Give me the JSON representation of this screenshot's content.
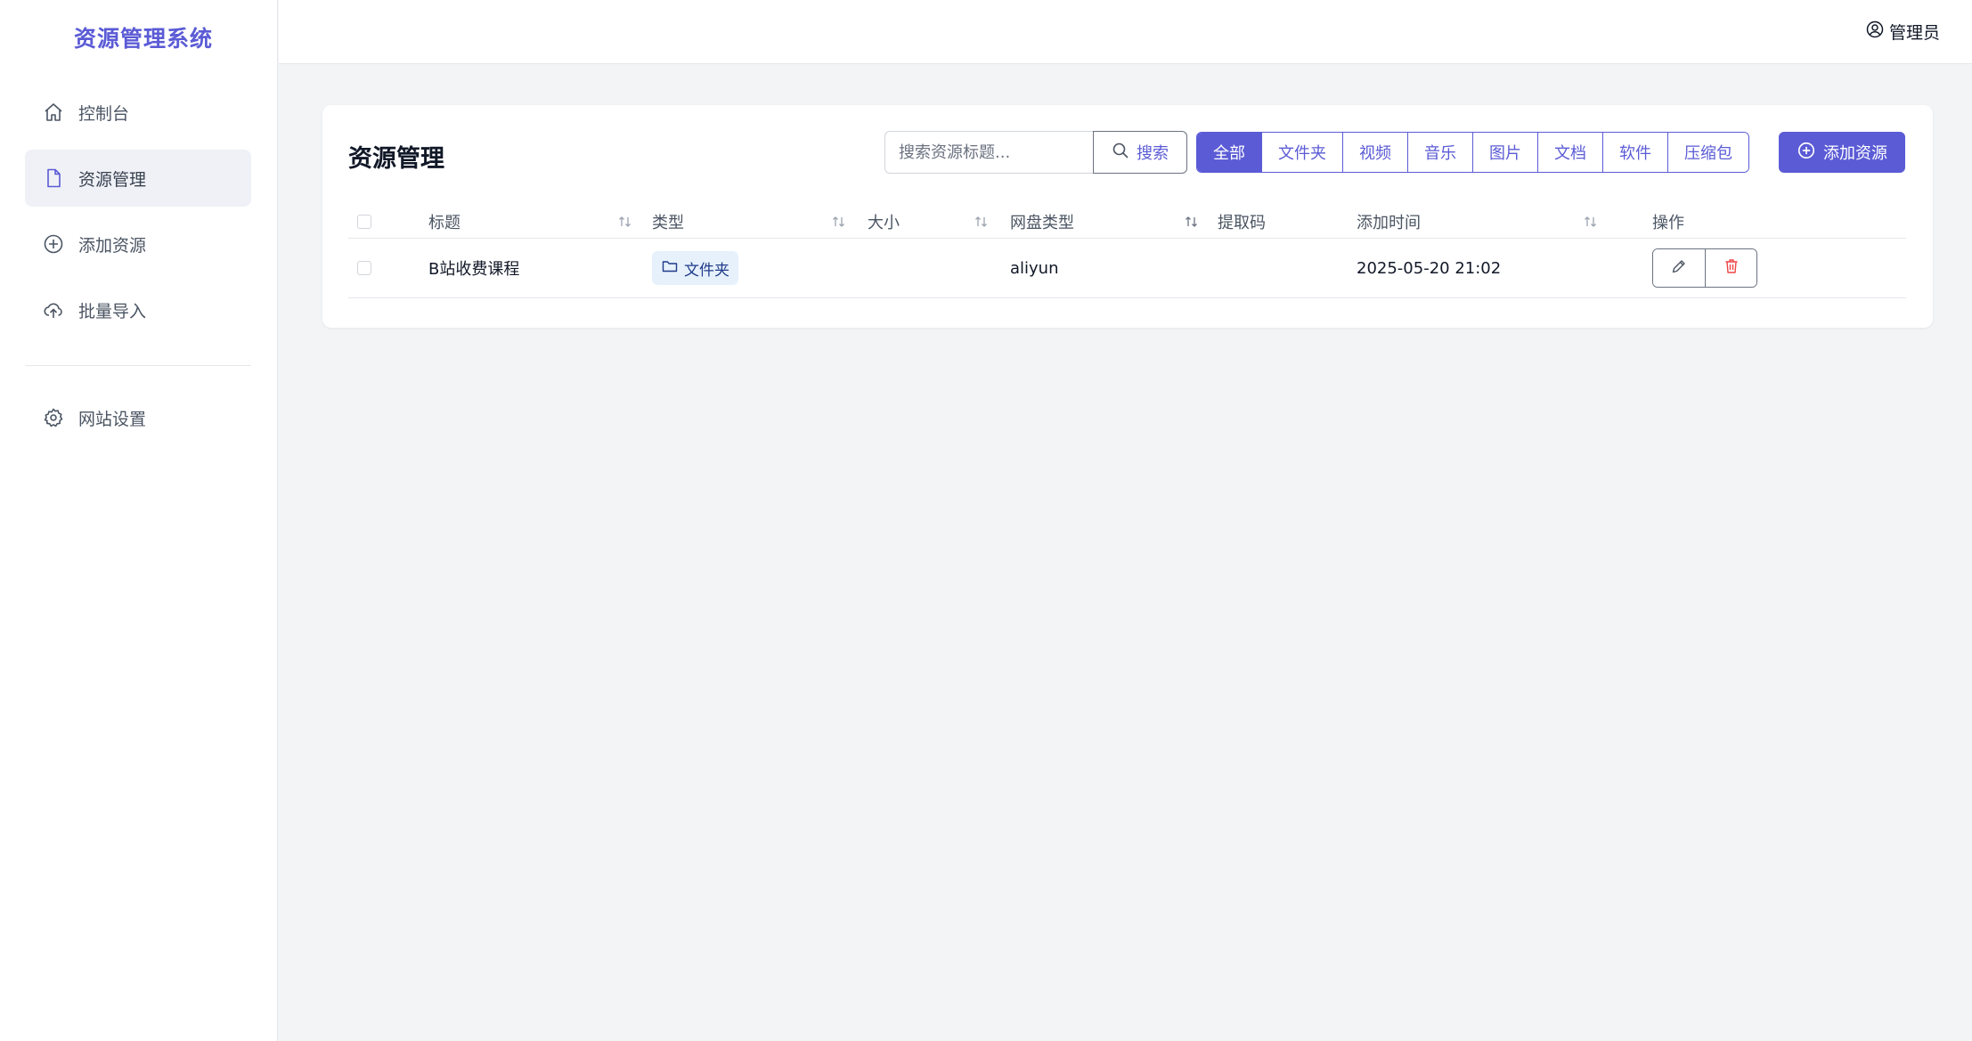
{
  "app": {
    "title": "资源管理系统"
  },
  "sidebar": {
    "items": [
      {
        "label": "控制台",
        "icon": "home-icon"
      },
      {
        "label": "资源管理",
        "icon": "file-icon",
        "active": true
      },
      {
        "label": "添加资源",
        "icon": "plus-circle-icon"
      },
      {
        "label": "批量导入",
        "icon": "cloud-upload-icon"
      }
    ],
    "settings": {
      "label": "网站设置",
      "icon": "gear-icon"
    }
  },
  "header": {
    "user_label": "管理员",
    "user_icon": "user-circle-icon"
  },
  "main": {
    "title": "资源管理",
    "search": {
      "placeholder": "搜索资源标题...",
      "value": "",
      "button_label": "搜索"
    },
    "filters": [
      "全部",
      "文件夹",
      "视频",
      "音乐",
      "图片",
      "文档",
      "软件",
      "压缩包"
    ],
    "active_filter": "全部",
    "add_button_label": "添加资源",
    "table": {
      "columns": [
        "标题",
        "类型",
        "大小",
        "网盘类型",
        "提取码",
        "添加时间",
        "操作"
      ],
      "rows": [
        {
          "title": "B站收费课程",
          "type": "文件夹",
          "size": "",
          "disk_type": "aliyun",
          "code": "",
          "added_time": "2025-05-20 21:02"
        }
      ]
    }
  },
  "colors": {
    "accent": "#5b5bd6",
    "delete": "#ef4444",
    "tag_bg": "#e6f1fb"
  }
}
